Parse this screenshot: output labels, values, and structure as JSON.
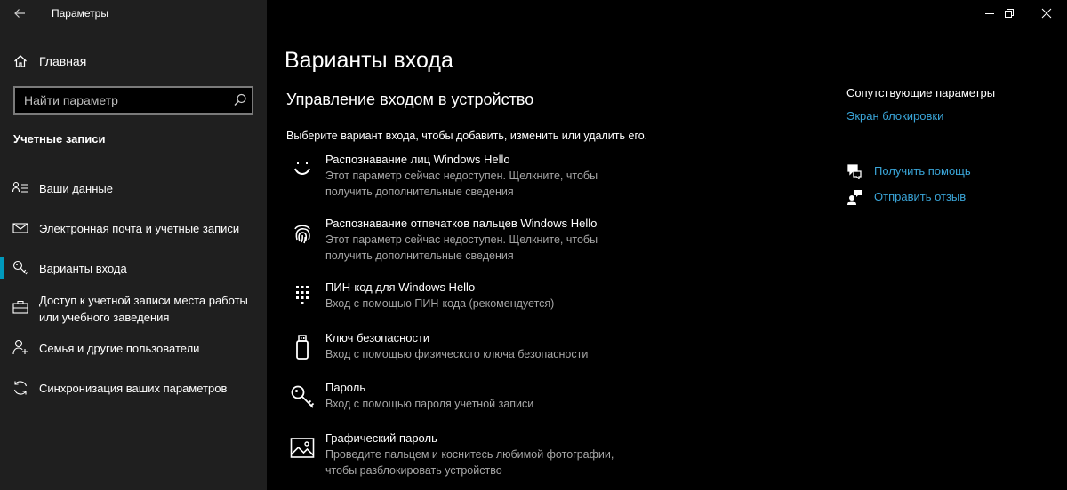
{
  "window": {
    "title": "Параметры",
    "controls": [
      "minimize-icon",
      "restore-icon",
      "close-icon"
    ]
  },
  "sidebar": {
    "home_label": "Главная",
    "search_placeholder": "Найти параметр",
    "section_title": "Учетные записи",
    "items": [
      {
        "label": "Ваши данные",
        "icon": "person-card-icon"
      },
      {
        "label": "Электронная почта и учетные записи",
        "icon": "mail-icon"
      },
      {
        "label": "Варианты входа",
        "icon": "key-icon",
        "selected": true
      },
      {
        "label": "Доступ к учетной записи места работы или учебного заведения",
        "icon": "briefcase-icon"
      },
      {
        "label": "Семья и другие пользователи",
        "icon": "person-add-icon"
      },
      {
        "label": "Синхронизация ваших параметров",
        "icon": "sync-icon"
      }
    ]
  },
  "main": {
    "title": "Варианты входа",
    "subtitle": "Управление входом в устройство",
    "instruction": "Выберите вариант входа, чтобы добавить, изменить или удалить его.",
    "options": [
      {
        "title": "Распознавание лиц Windows Hello",
        "desc": "Этот параметр сейчас недоступен. Щелкните, чтобы получить дополнительные сведения",
        "icon": "face-icon"
      },
      {
        "title": "Распознавание отпечатков пальцев Windows Hello",
        "desc": "Этот параметр сейчас недоступен. Щелкните, чтобы получить дополнительные сведения",
        "icon": "fingerprint-icon"
      },
      {
        "title": "ПИН-код для Windows Hello",
        "desc": "Вход с помощью ПИН-кода (рекомендуется)",
        "icon": "keypad-icon"
      },
      {
        "title": "Ключ безопасности",
        "desc": "Вход с помощью физического ключа безопасности",
        "icon": "usb-key-icon"
      },
      {
        "title": "Пароль",
        "desc": "Вход с помощью пароля учетной записи",
        "icon": "key-icon"
      },
      {
        "title": "Графический пароль",
        "desc": "Проведите пальцем и коснитесь любимой фотографии, чтобы разблокировать устройство",
        "icon": "picture-icon"
      }
    ]
  },
  "related": {
    "title": "Сопутствующие параметры",
    "lock_screen": "Экран блокировки",
    "get_help": "Получить помощь",
    "feedback": "Отправить отзыв"
  },
  "colors": {
    "accent": "#0099bc",
    "link": "#3aa5d8",
    "sidebar_bg": "#1f1f1f",
    "main_bg": "#000000",
    "muted_text": "#a6a6a6"
  }
}
